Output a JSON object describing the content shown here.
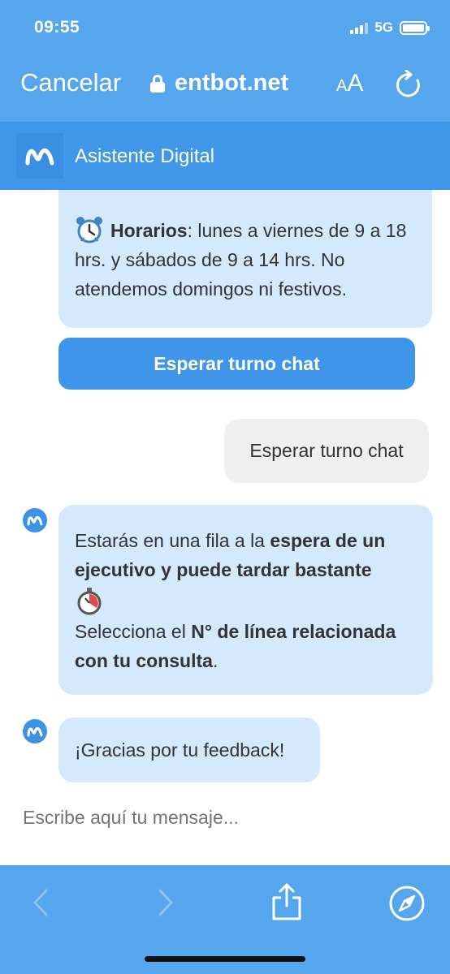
{
  "status": {
    "time": "09:55",
    "network": "5G"
  },
  "browser": {
    "cancel_label": "Cancelar",
    "url": "entbot.net",
    "aa_small": "A",
    "aa_big": "A"
  },
  "chat_header": {
    "title": "Asistente Digital"
  },
  "messages": {
    "hours": {
      "label": "Horarios",
      "text": ": lunes a viernes de 9 a 18 hrs. y sábados de 9 a 14 hrs. No atendemos domingos ni festivos."
    },
    "wait_button": "Esperar turno chat",
    "user_reply": "Esperar turno chat",
    "queue": {
      "part1": "Estarás en una fila a la ",
      "bold1": "espera de un ejecutivo y puede tardar bastante",
      "part2": "Selecciona el ",
      "bold2": "N° de línea relacionada con tu consulta",
      "part3": "."
    },
    "thanks": "¡Gracias por tu feedback!"
  },
  "input": {
    "placeholder": "Escribe aquí tu mensaje..."
  },
  "icons": {
    "brand": "movistar-m-icon",
    "alarm": "alarm-clock-icon",
    "stopwatch": "stopwatch-icon",
    "back": "chevron-left-icon",
    "forward": "chevron-right-icon",
    "share": "share-icon",
    "compass": "compass-icon"
  },
  "colors": {
    "primary": "#56a6ee",
    "header": "#4096e8",
    "bot_bubble": "#d4e9fb",
    "user_bubble": "#efefef",
    "button": "#3f95ea"
  }
}
